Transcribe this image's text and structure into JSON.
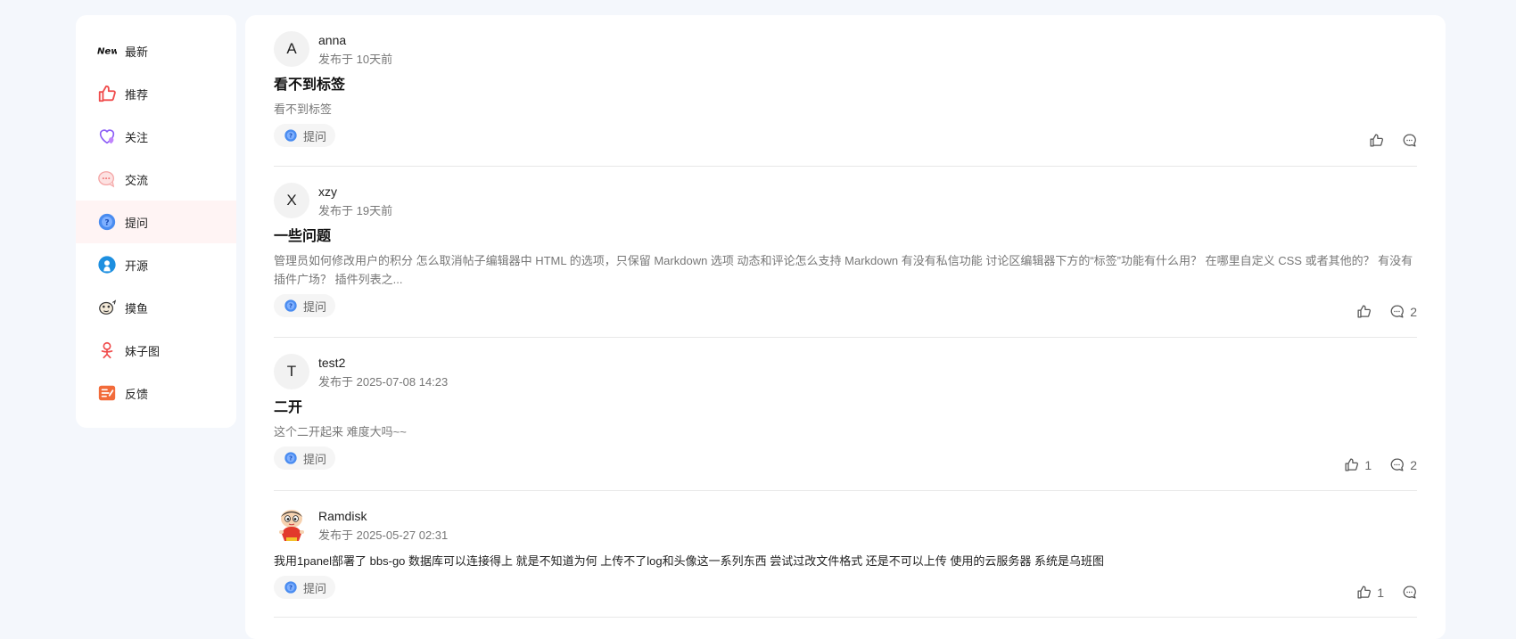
{
  "sidebar": {
    "items": [
      {
        "label": "最新",
        "icon": "new-icon",
        "active": false
      },
      {
        "label": "推荐",
        "icon": "thumb-icon",
        "active": false
      },
      {
        "label": "关注",
        "icon": "heart-icon",
        "active": false
      },
      {
        "label": "交流",
        "icon": "chat-bubble-icon",
        "active": false
      },
      {
        "label": "提问",
        "icon": "question-icon",
        "active": true
      },
      {
        "label": "开源",
        "icon": "open-source-icon",
        "active": false
      },
      {
        "label": "摸鱼",
        "icon": "fish-icon",
        "active": false
      },
      {
        "label": "妹子图",
        "icon": "girl-icon",
        "active": false
      },
      {
        "label": "反馈",
        "icon": "feedback-icon",
        "active": false
      }
    ],
    "new_logo_text": "New"
  },
  "posts": [
    {
      "avatar_letter": "A",
      "username": "anna",
      "time": "发布于 10天前",
      "title": "看不到标签",
      "summary": "看不到标签",
      "tag": "提问",
      "likes": "",
      "comments": ""
    },
    {
      "avatar_letter": "X",
      "username": "xzy",
      "time": "发布于 19天前",
      "title": "一些问题",
      "summary": "管理员如何修改用户的积分 怎么取消帖子编辑器中 HTML 的选项，只保留 Markdown 选项 动态和评论怎么支持 Markdown 有没有私信功能 讨论区编辑器下方的“标签”功能有什么用？ 在哪里自定义 CSS 或者其他的？ 有没有插件广场？ 插件列表之...",
      "tag": "提问",
      "likes": "",
      "comments": "2"
    },
    {
      "avatar_letter": "T",
      "username": "test2",
      "time": "发布于 2025-07-08 14:23",
      "title": "二开",
      "summary": "这个二开起来 难度大吗~~",
      "tag": "提问",
      "likes": "1",
      "comments": "2"
    },
    {
      "avatar_letter": "",
      "username": "Ramdisk",
      "time": "发布于 2025-05-27 02:31",
      "title": "",
      "summary": "我用1panel部署了 bbs-go 数据库可以连接得上 就是不知道为何 上传不了log和头像这一系列东西 尝试过改文件格式 还是不可以上传 使用的云服务器 系统是乌班图",
      "tag": "提问",
      "likes": "1",
      "comments": ""
    }
  ],
  "colors": {
    "accent_red": "#f04b4b",
    "active_bg": "#fff4f4",
    "question_blue": "#4a8cf0"
  }
}
